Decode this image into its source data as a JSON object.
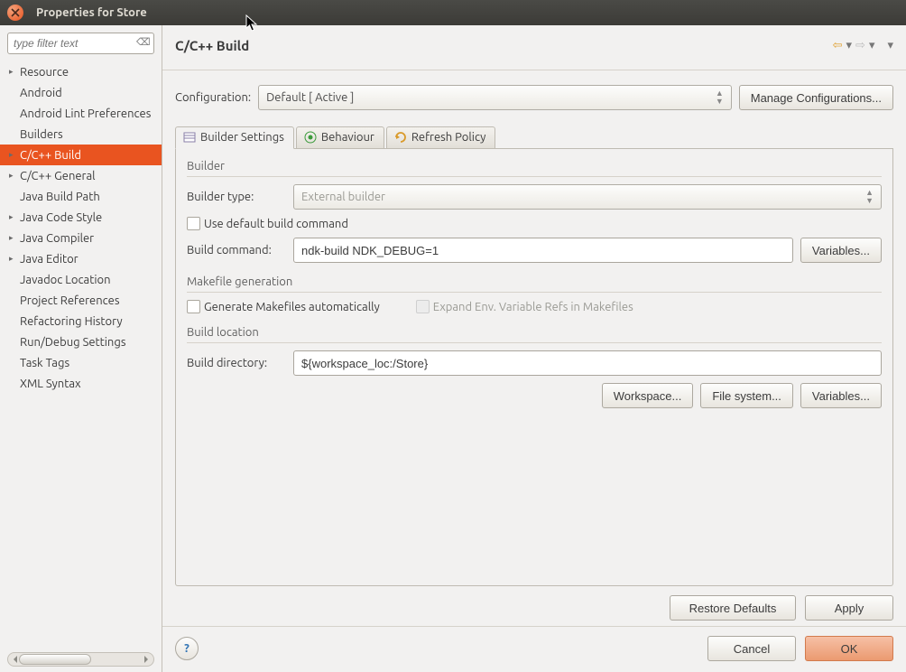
{
  "window": {
    "title": "Properties for Store"
  },
  "sidebar": {
    "filter_placeholder": "type filter text",
    "items": [
      {
        "label": "Resource",
        "expandable": true
      },
      {
        "label": "Android",
        "expandable": false
      },
      {
        "label": "Android Lint Preferences",
        "expandable": false
      },
      {
        "label": "Builders",
        "expandable": false
      },
      {
        "label": "C/C++ Build",
        "expandable": true,
        "selected": true
      },
      {
        "label": "C/C++ General",
        "expandable": true
      },
      {
        "label": "Java Build Path",
        "expandable": false
      },
      {
        "label": "Java Code Style",
        "expandable": true
      },
      {
        "label": "Java Compiler",
        "expandable": true
      },
      {
        "label": "Java Editor",
        "expandable": true
      },
      {
        "label": "Javadoc Location",
        "expandable": false
      },
      {
        "label": "Project References",
        "expandable": false
      },
      {
        "label": "Refactoring History",
        "expandable": false
      },
      {
        "label": "Run/Debug Settings",
        "expandable": false
      },
      {
        "label": "Task Tags",
        "expandable": false
      },
      {
        "label": "XML Syntax",
        "expandable": false
      }
    ]
  },
  "header": {
    "title": "C/C++ Build"
  },
  "config": {
    "label": "Configuration:",
    "value": "Default  [ Active ]",
    "manage_btn": "Manage Configurations..."
  },
  "tabs": {
    "builder_settings": "Builder Settings",
    "behaviour": "Behaviour",
    "refresh_policy": "Refresh Policy"
  },
  "builder": {
    "group": "Builder",
    "type_label": "Builder type:",
    "type_value": "External builder",
    "use_default_label": "Use default build command",
    "cmd_label": "Build command:",
    "cmd_value": "ndk-build NDK_DEBUG=1",
    "variables_btn": "Variables..."
  },
  "makefile": {
    "group": "Makefile generation",
    "generate_label": "Generate Makefiles automatically",
    "expand_label": "Expand Env. Variable Refs in Makefiles"
  },
  "location": {
    "group": "Build location",
    "dir_label": "Build directory:",
    "dir_value": "${workspace_loc:/Store}",
    "workspace_btn": "Workspace...",
    "filesystem_btn": "File system...",
    "variables_btn": "Variables..."
  },
  "footer": {
    "restore": "Restore Defaults",
    "apply": "Apply",
    "cancel": "Cancel",
    "ok": "OK"
  }
}
